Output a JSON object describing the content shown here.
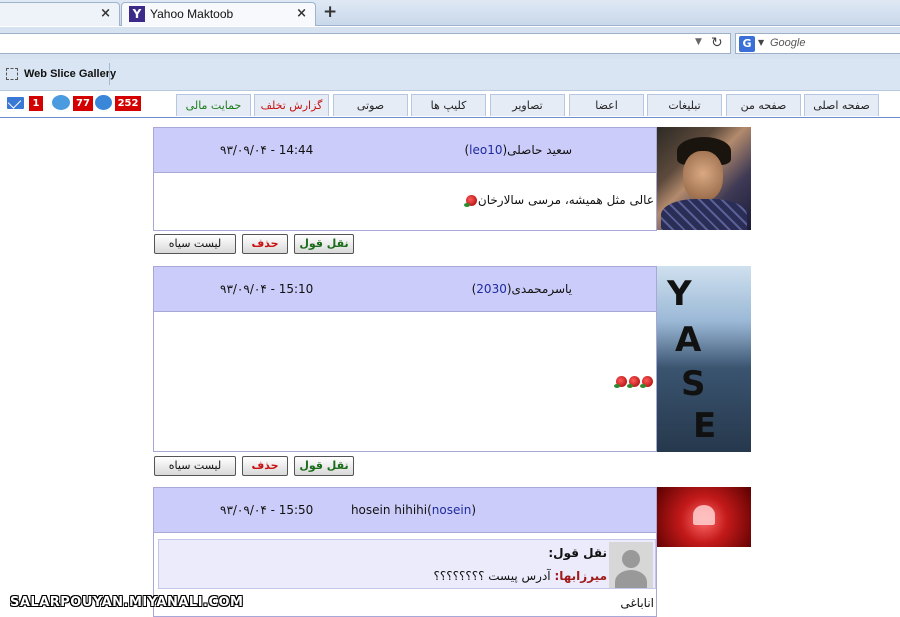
{
  "browser": {
    "tabs": [
      {
        "title": ""
      },
      {
        "title": "Yahoo Maktoob",
        "favicon": "Y"
      }
    ],
    "new_tab": "+",
    "close_glyph": "×",
    "search_engine_icon": "G",
    "search_placeholder": "Google",
    "favorites": {
      "label": "Web Slice Gallery"
    }
  },
  "site_toolbar": {
    "notifications": {
      "mail": "1",
      "chat": "77",
      "comments": "252"
    },
    "nav": [
      {
        "label": "صفحه اصلی"
      },
      {
        "label": "صفحه من"
      },
      {
        "label": "تبلیغات"
      },
      {
        "label": "اعضا"
      },
      {
        "label": "تصاویر"
      },
      {
        "label": "کلیپ ها"
      },
      {
        "label": "صوتی"
      },
      {
        "label": "گزارش تخلف"
      },
      {
        "label": "حمایت مالی"
      }
    ]
  },
  "posts": [
    {
      "author": "سعید حاصلی(",
      "uid": "leo10",
      "author_close": ")",
      "time": "۹۳/۰۹/۰۴ - 14:44",
      "text": "عالی مثل همیشه، مرسی سالارخان"
    },
    {
      "author": "یاسرمحمدی(",
      "uid": "2030",
      "author_close": ")",
      "time": "۹۳/۰۹/۰۴ - 15:10",
      "avatar_letters": [
        "Y",
        "A",
        "S",
        "E"
      ],
      "text": ""
    },
    {
      "author": "hosein hihihi(",
      "uid": "nosein",
      "author_close": ")",
      "time": "۹۳/۰۹/۰۴ - 15:50",
      "quote_label": "نقل قول:",
      "quote_name": "میرزابها:",
      "quote_text": " آدرس پیست ؟؟؟؟؟؟؟؟",
      "poster_name": "اناباغی"
    }
  ],
  "actions": {
    "quote": "نقل قول",
    "delete": "حذف",
    "blacklist": "لیست سیاه"
  },
  "watermark": "SALARPOUYAN.MIYANALI.COM",
  "colors": {
    "header_bg": "#ccccfa",
    "uid": "#1d2b9e",
    "delete": "#c81212",
    "quote": "#1a6b1a"
  }
}
